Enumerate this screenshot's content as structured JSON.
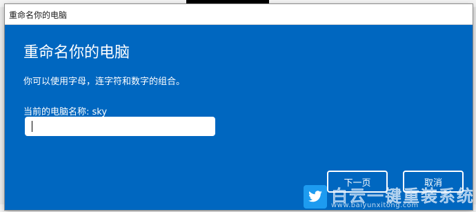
{
  "dialog": {
    "window_title": "重命名你的电脑",
    "heading": "重命名你的电脑",
    "description": "你可以使用字母，连字符和数字的组合。",
    "current_name_label": "当前的电脑名称: sky",
    "name_input": {
      "value": "",
      "placeholder": ""
    },
    "next_label": "下一页",
    "cancel_label": "取消"
  },
  "watermark": {
    "brand_text": "白云一键重装系统",
    "url": "www.baiyunxitong.com",
    "icon": "bird-icon"
  },
  "colors": {
    "dialog_background": "#0067c0",
    "titlebar_background": "#ffffff",
    "text_on_accent": "#ffffff"
  }
}
